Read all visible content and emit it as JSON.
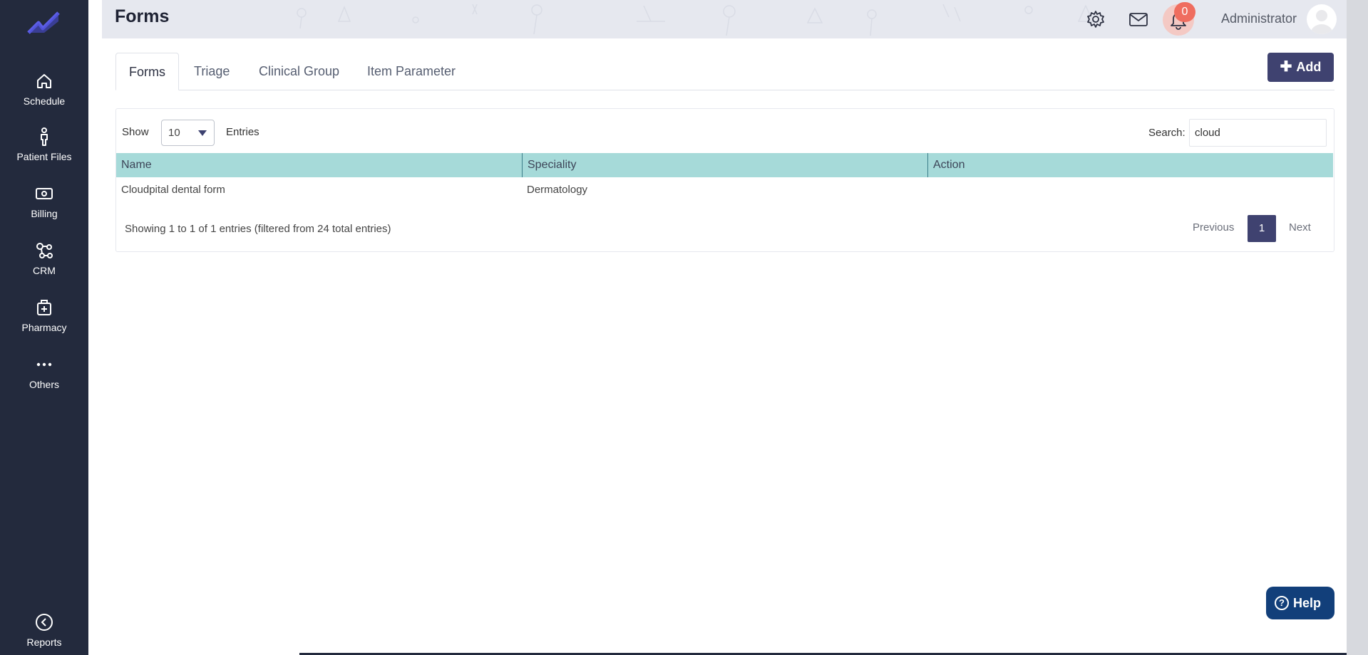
{
  "sidebar": {
    "logo_icon": "trend-logo-icon",
    "items": [
      {
        "label": "Schedule",
        "icon": "home-icon"
      },
      {
        "label": "Patient Files",
        "icon": "person-icon"
      },
      {
        "label": "Billing",
        "icon": "money-icon"
      },
      {
        "label": "CRM",
        "icon": "network-icon"
      },
      {
        "label": "Pharmacy",
        "icon": "medical-bag-icon"
      },
      {
        "label": "Others",
        "icon": "more-dots-icon"
      },
      {
        "label": "Reports",
        "icon": "back-circle-icon"
      }
    ]
  },
  "header": {
    "title": "Forms",
    "notification_count": "0",
    "user_name": "Administrator"
  },
  "tabs": [
    {
      "label": "Forms",
      "active": true
    },
    {
      "label": "Triage",
      "active": false
    },
    {
      "label": "Clinical Group",
      "active": false
    },
    {
      "label": "Item Parameter",
      "active": false
    }
  ],
  "toolbar": {
    "add_label": "Add"
  },
  "table_controls": {
    "show_label": "Show",
    "page_size": "10",
    "entries_label": "Entries",
    "search_label": "Search:",
    "search_value": "cloud"
  },
  "table": {
    "columns": [
      "Name",
      "Speciality",
      "Action"
    ],
    "rows": [
      {
        "name": "Cloudpital dental form",
        "speciality": "Dermatology",
        "action": ""
      }
    ]
  },
  "pagination": {
    "info": "Showing 1 to 1 of 1 entries (filtered from 24 total entries)",
    "previous": "Previous",
    "current": "1",
    "next": "Next"
  },
  "help": {
    "label": "Help"
  },
  "colors": {
    "sidebar_bg": "#232a3d",
    "accent": "#3f4270",
    "table_header": "#a6dad9",
    "help_bg": "#123f7a",
    "badge": "#ef6d5f"
  }
}
